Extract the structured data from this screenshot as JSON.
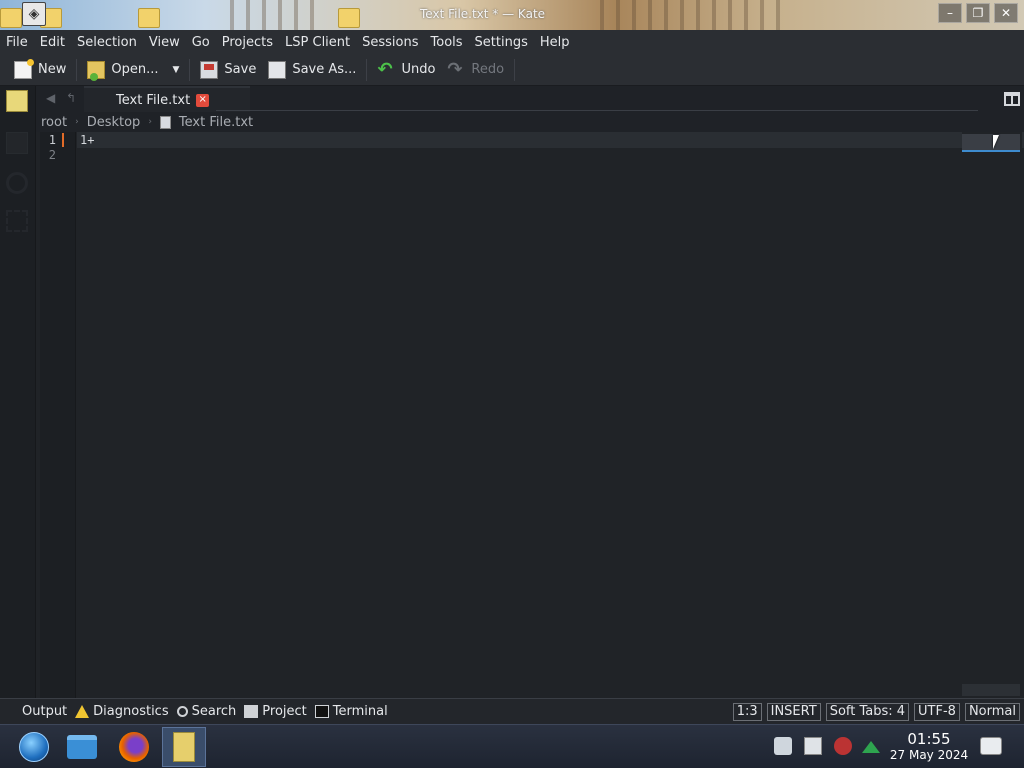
{
  "window": {
    "title": "Text File.txt * — Kate",
    "buttons": [
      "–",
      "❐",
      "✕"
    ]
  },
  "menu": [
    "File",
    "Edit",
    "Selection",
    "View",
    "Go",
    "Projects",
    "LSP Client",
    "Sessions",
    "Tools",
    "Settings",
    "Help"
  ],
  "toolbar": {
    "new_label": "New",
    "open_label": "Open...",
    "save_label": "Save",
    "saveas_label": "Save As...",
    "undo_label": "Undo",
    "redo_label": "Redo"
  },
  "tabs": [
    {
      "label": "Text File.txt",
      "modified": true
    }
  ],
  "breadcrumb": [
    "root",
    "Desktop",
    "Text File.txt"
  ],
  "editor": {
    "lines": [
      {
        "number": "1",
        "text": "1+"
      },
      {
        "number": "2",
        "text": ""
      }
    ]
  },
  "bottom_tools": [
    "Output",
    "Diagnostics",
    "Search",
    "Project",
    "Terminal"
  ],
  "status": {
    "position": "1:3",
    "mode": "INSERT",
    "indent": "Soft Tabs: 4",
    "encoding": "UTF-8",
    "input_mode": "Normal"
  },
  "clock": {
    "time": "01:55",
    "date": "27 May 2024"
  },
  "colors": {
    "editor_bg": "#202327",
    "modified_marker": "#e26b28",
    "tab_close": "#e34b3c",
    "minimap_accent": "#3e8ccf"
  }
}
